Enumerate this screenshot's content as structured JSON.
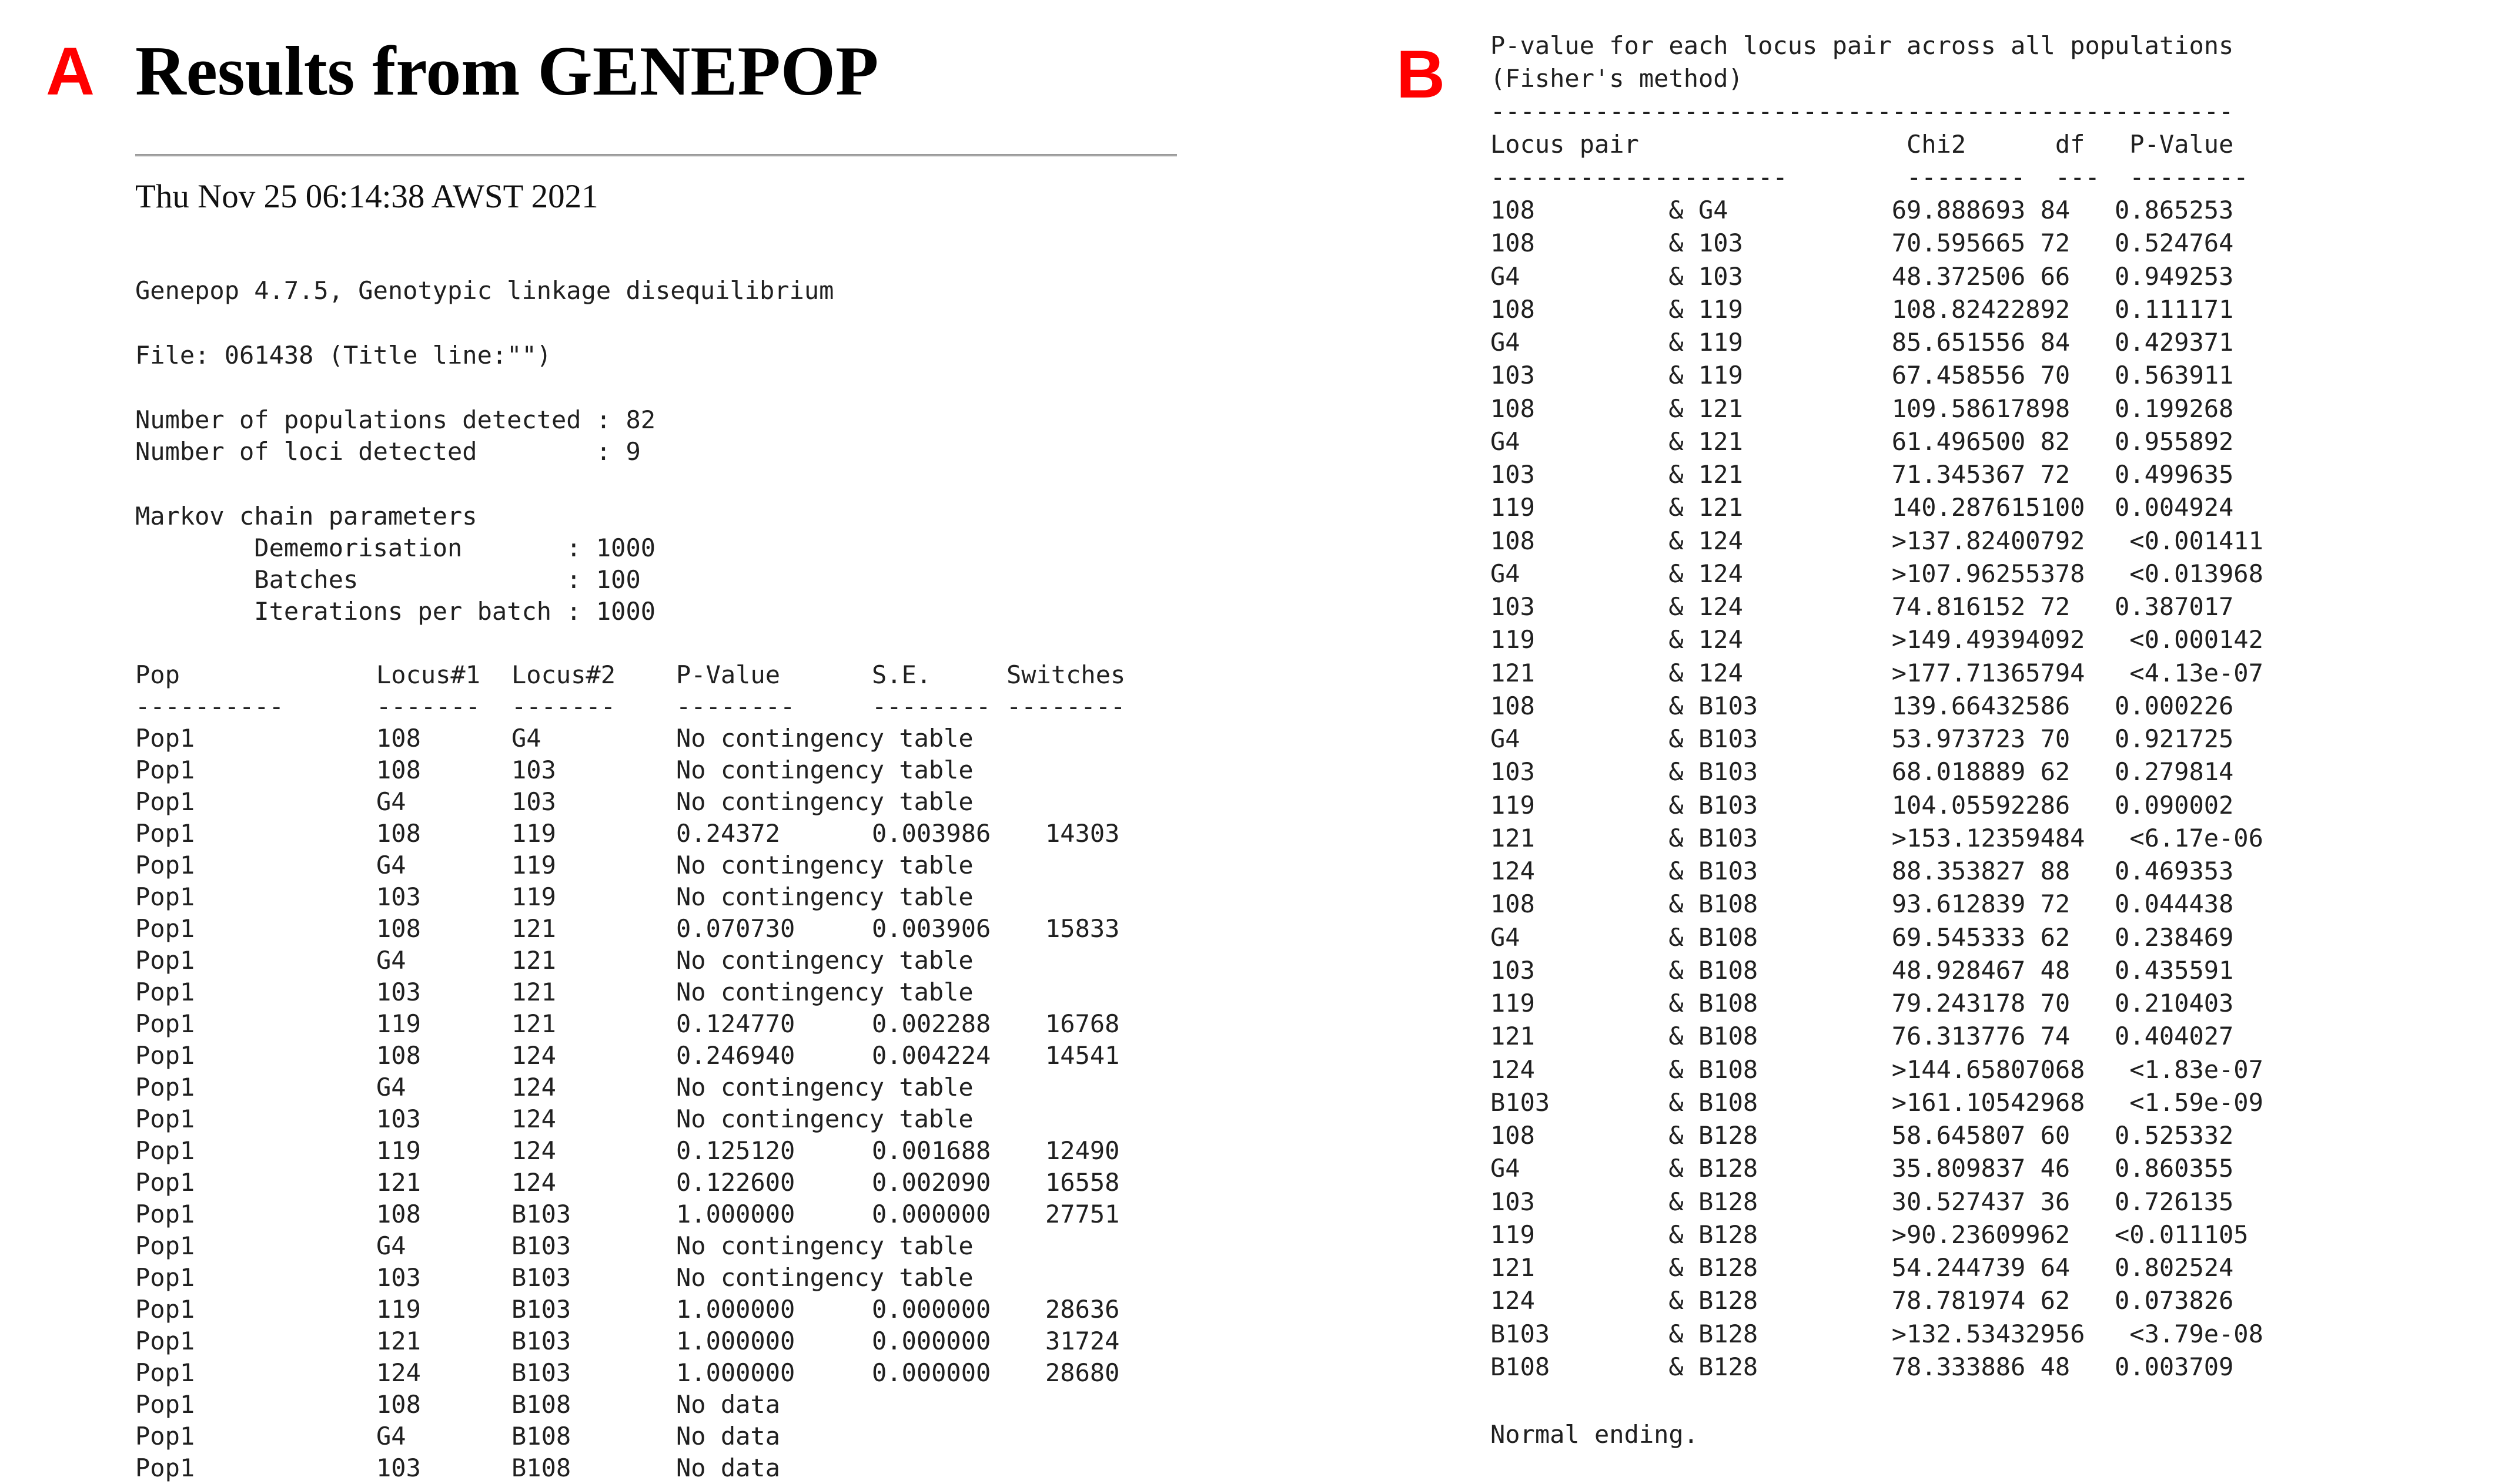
{
  "labels": {
    "a": "A",
    "b": "B"
  },
  "panel_a": {
    "title": "Results from GENEPOP",
    "date": "Thu Nov 25 06:14:38 AWST 2021",
    "program_line": "Genepop 4.7.5, Genotypic linkage disequilibrium",
    "file_line": "File: 061438 (Title line:\"\")",
    "pops_line": "Number of populations detected : 82",
    "loci_line": "Number of loci detected        : 9",
    "markov_title": "Markov chain parameters",
    "dememorisation_line": "        Dememorisation       : 1000",
    "batches_line": "        Batches              : 100",
    "iterations_line": "        Iterations per batch : 1000",
    "columns": [
      "Pop",
      "Locus#1",
      "Locus#2",
      "P-Value",
      "S.E.",
      "Switches"
    ],
    "separators": [
      "----------",
      "-------",
      "-------",
      "--------",
      "--------",
      "--------"
    ],
    "rows": [
      [
        "Pop1",
        "108",
        "G4",
        "No contingency table",
        "",
        ""
      ],
      [
        "Pop1",
        "108",
        "103",
        "No contingency table",
        "",
        ""
      ],
      [
        "Pop1",
        "G4",
        "103",
        "No contingency table",
        "",
        ""
      ],
      [
        "Pop1",
        "108",
        "119",
        "0.24372",
        "0.003986",
        "14303"
      ],
      [
        "Pop1",
        "G4",
        "119",
        "No contingency table",
        "",
        ""
      ],
      [
        "Pop1",
        "103",
        "119",
        "No contingency table",
        "",
        ""
      ],
      [
        "Pop1",
        "108",
        "121",
        "0.070730",
        "0.003906",
        "15833"
      ],
      [
        "Pop1",
        "G4",
        "121",
        "No contingency table",
        "",
        ""
      ],
      [
        "Pop1",
        "103",
        "121",
        "No contingency table",
        "",
        ""
      ],
      [
        "Pop1",
        "119",
        "121",
        "0.124770",
        "0.002288",
        "16768"
      ],
      [
        "Pop1",
        "108",
        "124",
        "0.246940",
        "0.004224",
        "14541"
      ],
      [
        "Pop1",
        "G4",
        "124",
        "No contingency table",
        "",
        ""
      ],
      [
        "Pop1",
        "103",
        "124",
        "No contingency table",
        "",
        ""
      ],
      [
        "Pop1",
        "119",
        "124",
        "0.125120",
        "0.001688",
        "12490"
      ],
      [
        "Pop1",
        "121",
        "124",
        "0.122600",
        "0.002090",
        "16558"
      ],
      [
        "Pop1",
        "108",
        "B103",
        "1.000000",
        "0.000000",
        "27751"
      ],
      [
        "Pop1",
        "G4",
        "B103",
        "No contingency table",
        "",
        ""
      ],
      [
        "Pop1",
        "103",
        "B103",
        "No contingency table",
        "",
        ""
      ],
      [
        "Pop1",
        "119",
        "B103",
        "1.000000",
        "0.000000",
        "28636"
      ],
      [
        "Pop1",
        "121",
        "B103",
        "1.000000",
        "0.000000",
        "31724"
      ],
      [
        "Pop1",
        "124",
        "B103",
        "1.000000",
        "0.000000",
        "28680"
      ],
      [
        "Pop1",
        "108",
        "B108",
        "No data",
        "",
        ""
      ],
      [
        "Pop1",
        "G4",
        "B108",
        "No data",
        "",
        ""
      ],
      [
        "Pop1",
        "103",
        "B108",
        "No data",
        "",
        ""
      ]
    ]
  },
  "panel_b": {
    "header_line1": "P-value for each locus pair across all populations",
    "header_line2": "(Fisher's method)",
    "rule": "--------------------------------------------------",
    "column_header": "Locus pair                  Chi2      df   P-Value",
    "column_rule": "--------------------        --------  ---  --------",
    "rows": [
      "108         & G4           69.888693 84   0.865253",
      "108         & 103          70.595665 72   0.524764",
      "G4          & 103          48.372506 66   0.949253",
      "108         & 119          108.82422892   0.111171",
      "G4          & 119          85.651556 84   0.429371",
      "103         & 119          67.458556 70   0.563911",
      "108         & 121          109.58617898   0.199268",
      "G4          & 121          61.496500 82   0.955892",
      "103         & 121          71.345367 72   0.499635",
      "119         & 121          140.287615100  0.004924",
      "108         & 124          >137.82400792   <0.001411",
      "G4          & 124          >107.96255378   <0.013968",
      "103         & 124          74.816152 72   0.387017",
      "119         & 124          >149.49394092   <0.000142",
      "121         & 124          >177.71365794   <4.13e-07",
      "108         & B103         139.66432586   0.000226",
      "G4          & B103         53.973723 70   0.921725",
      "103         & B103         68.018889 62   0.279814",
      "119         & B103         104.05592286   0.090002",
      "121         & B103         >153.12359484   <6.17e-06",
      "124         & B103         88.353827 88   0.469353",
      "108         & B108         93.612839 72   0.044438",
      "G4          & B108         69.545333 62   0.238469",
      "103         & B108         48.928467 48   0.435591",
      "119         & B108         79.243178 70   0.210403",
      "121         & B108         76.313776 74   0.404027",
      "124         & B108         >144.65807068   <1.83e-07",
      "B103        & B108         >161.10542968   <1.59e-09",
      "108         & B128         58.645807 60   0.525332",
      "G4          & B128         35.809837 46   0.860355",
      "103         & B128         30.527437 36   0.726135",
      "119         & B128         >90.23609962   <0.011105",
      "121         & B128         54.244739 64   0.802524",
      "124         & B128         78.781974 62   0.073826",
      "B103        & B128         >132.53432956   <3.79e-08",
      "B108        & B128         78.333886 48   0.003709"
    ],
    "footer": "Normal ending."
  }
}
